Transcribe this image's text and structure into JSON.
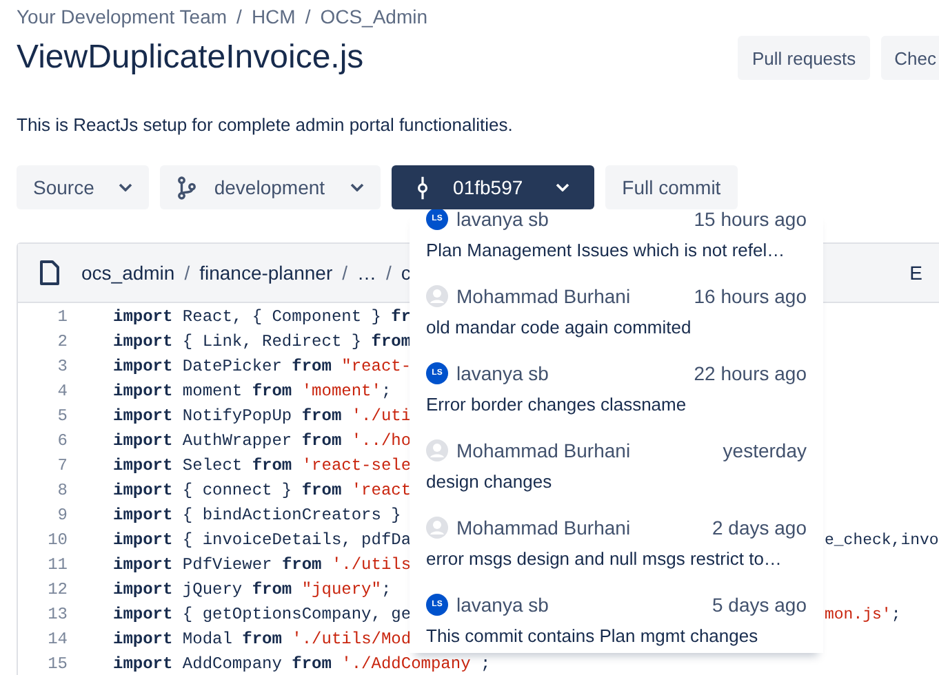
{
  "breadcrumbs": {
    "separator": "/",
    "items": [
      "Your Development Team",
      "HCM",
      "OCS_Admin"
    ]
  },
  "title": "ViewDuplicateInvoice.js",
  "header_buttons": [
    "Pull requests",
    "Chec"
  ],
  "description": "This is ReactJs setup for complete admin portal functionalities.",
  "toolbar": [
    {
      "kind": "dropdown",
      "label": "Source"
    },
    {
      "kind": "branch",
      "label": "development"
    },
    {
      "kind": "commit",
      "label": "01fb597"
    },
    {
      "kind": "plain",
      "label": "Full commit"
    }
  ],
  "file_header": {
    "separator": "/",
    "path": [
      "ocs_admin",
      "finance-planner",
      "…",
      "c"
    ],
    "action": "E"
  },
  "code_lines": [
    {
      "number": "1",
      "tokens": [
        {
          "kind": "keyword",
          "text": "import"
        },
        {
          "kind": "plain",
          "text": " React, { Component } "
        },
        {
          "kind": "keyword",
          "text": "fr"
        }
      ]
    },
    {
      "number": "2",
      "tokens": [
        {
          "kind": "keyword",
          "text": "import"
        },
        {
          "kind": "plain",
          "text": " { Link, Redirect } "
        },
        {
          "kind": "keyword",
          "text": "from"
        }
      ]
    },
    {
      "number": "3",
      "tokens": [
        {
          "kind": "keyword",
          "text": "import"
        },
        {
          "kind": "plain",
          "text": " DatePicker "
        },
        {
          "kind": "keyword",
          "text": "from"
        },
        {
          "kind": "string",
          "text": " \"react-"
        }
      ]
    },
    {
      "number": "4",
      "tokens": [
        {
          "kind": "keyword",
          "text": "import"
        },
        {
          "kind": "plain",
          "text": " moment "
        },
        {
          "kind": "keyword",
          "text": "from"
        },
        {
          "kind": "string",
          "text": " 'moment'"
        },
        {
          "kind": "plain",
          "text": ";"
        }
      ]
    },
    {
      "number": "5",
      "tokens": [
        {
          "kind": "keyword",
          "text": "import"
        },
        {
          "kind": "plain",
          "text": " NotifyPopUp "
        },
        {
          "kind": "keyword",
          "text": "from"
        },
        {
          "kind": "string",
          "text": " './uti"
        }
      ]
    },
    {
      "number": "6",
      "tokens": [
        {
          "kind": "keyword",
          "text": "import"
        },
        {
          "kind": "plain",
          "text": " AuthWrapper "
        },
        {
          "kind": "keyword",
          "text": "from"
        },
        {
          "kind": "string",
          "text": " '../ho"
        }
      ]
    },
    {
      "number": "7",
      "tokens": [
        {
          "kind": "keyword",
          "text": "import"
        },
        {
          "kind": "plain",
          "text": " Select "
        },
        {
          "kind": "keyword",
          "text": "from"
        },
        {
          "kind": "string",
          "text": " 'react-sele"
        }
      ]
    },
    {
      "number": "8",
      "tokens": [
        {
          "kind": "keyword",
          "text": "import"
        },
        {
          "kind": "plain",
          "text": " { connect } "
        },
        {
          "kind": "keyword",
          "text": "from"
        },
        {
          "kind": "string",
          "text": " 'react"
        }
      ]
    },
    {
      "number": "9",
      "tokens": [
        {
          "kind": "keyword",
          "text": "import"
        },
        {
          "kind": "plain",
          "text": " { bindActionCreators }"
        }
      ]
    },
    {
      "number": "10",
      "tokens": [
        {
          "kind": "keyword",
          "text": "import"
        },
        {
          "kind": "plain",
          "text": " { invoiceDetails, pdfDa"
        }
      ],
      "tail": [
        {
          "kind": "plain",
          "text": "e_check,invo"
        }
      ]
    },
    {
      "number": "11",
      "tokens": [
        {
          "kind": "keyword",
          "text": "import"
        },
        {
          "kind": "plain",
          "text": " PdfViewer "
        },
        {
          "kind": "keyword",
          "text": "from"
        },
        {
          "kind": "string",
          "text": " './utils"
        }
      ]
    },
    {
      "number": "12",
      "tokens": [
        {
          "kind": "keyword",
          "text": "import"
        },
        {
          "kind": "plain",
          "text": " jQuery "
        },
        {
          "kind": "keyword",
          "text": "from"
        },
        {
          "kind": "string",
          "text": " \"jquery\""
        },
        {
          "kind": "plain",
          "text": ";"
        }
      ]
    },
    {
      "number": "13",
      "tokens": [
        {
          "kind": "keyword",
          "text": "import"
        },
        {
          "kind": "plain",
          "text": " { getOptionsCompany, ge"
        }
      ],
      "tail": [
        {
          "kind": "string",
          "text": "mon.js'"
        },
        {
          "kind": "plain",
          "text": ";"
        }
      ]
    },
    {
      "number": "14",
      "tokens": [
        {
          "kind": "keyword",
          "text": "import"
        },
        {
          "kind": "plain",
          "text": " Modal "
        },
        {
          "kind": "keyword",
          "text": "from"
        },
        {
          "kind": "string",
          "text": " './utils/Mod"
        }
      ]
    },
    {
      "number": "15",
      "tokens": [
        {
          "kind": "keyword",
          "text": "import"
        },
        {
          "kind": "plain",
          "text": " AddCompany "
        },
        {
          "kind": "keyword",
          "text": "from"
        },
        {
          "kind": "string",
          "text": " './AddCompany"
        },
        {
          "kind": "plain",
          "text": " ;"
        }
      ]
    }
  ],
  "commits": [
    {
      "kind": "initials",
      "initials": "LS",
      "author": "lavanya sb",
      "time": "15 hours ago",
      "message": "Plan Management Issues which is not refel…"
    },
    {
      "kind": "default",
      "author": "Mohammad Burhani",
      "time": "16 hours ago",
      "message": "old mandar code again commited"
    },
    {
      "kind": "initials",
      "initials": "LS",
      "author": "lavanya sb",
      "time": "22 hours ago",
      "message": "Error border changes classname"
    },
    {
      "kind": "default",
      "author": "Mohammad Burhani",
      "time": "yesterday",
      "message": "design changes"
    },
    {
      "kind": "default",
      "author": "Mohammad Burhani",
      "time": "2 days ago",
      "message": "error msgs design and null msgs restrict to…"
    },
    {
      "kind": "initials",
      "initials": "LS",
      "author": "lavanya sb",
      "time": "5 days ago",
      "message": "This commit contains Plan mgmt changes"
    }
  ]
}
